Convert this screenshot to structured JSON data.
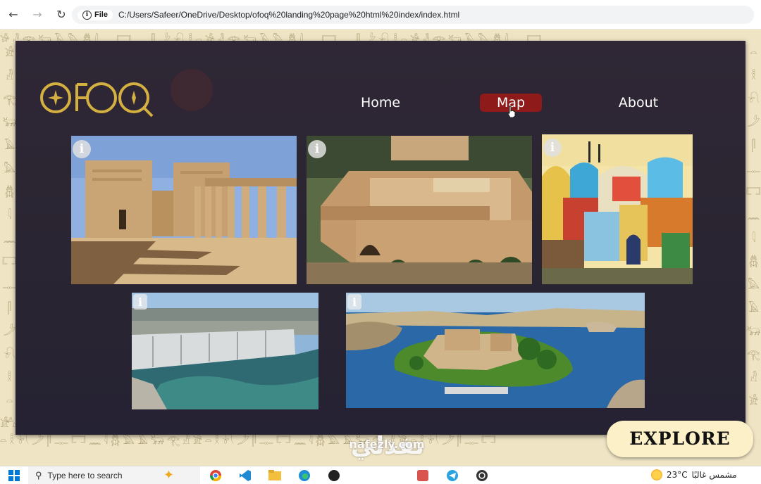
{
  "browser": {
    "file_label": "File",
    "url": "C:/Users/Safeer/OneDrive/Desktop/ofoq%20landing%20page%20html%20index/index.html"
  },
  "brand": {
    "logo_text": "OFOQ"
  },
  "nav": {
    "home": "Home",
    "map": "Map",
    "about": "About"
  },
  "gallery": {
    "info_glyph": "i",
    "items": [
      {
        "subject": "philae-temple-pylon"
      },
      {
        "subject": "desert-stone-fortress"
      },
      {
        "subject": "colorful-nubian-village"
      },
      {
        "subject": "aswan-dam-spillway"
      },
      {
        "subject": "philae-island-aerial"
      }
    ]
  },
  "cta": {
    "explore": "EXPLORE"
  },
  "watermark": {
    "arabic": "نفذلي",
    "url": "nafezly.com"
  },
  "taskbar": {
    "search_placeholder": "Type here to search",
    "weather_temp": "23°C",
    "weather_desc": "مشمس غالبًا"
  },
  "colors": {
    "panel": "#2a2532",
    "active_nav": "#8e1a1a",
    "logo_gold": "#d4b041",
    "explore_bg": "#fbf0c8"
  }
}
